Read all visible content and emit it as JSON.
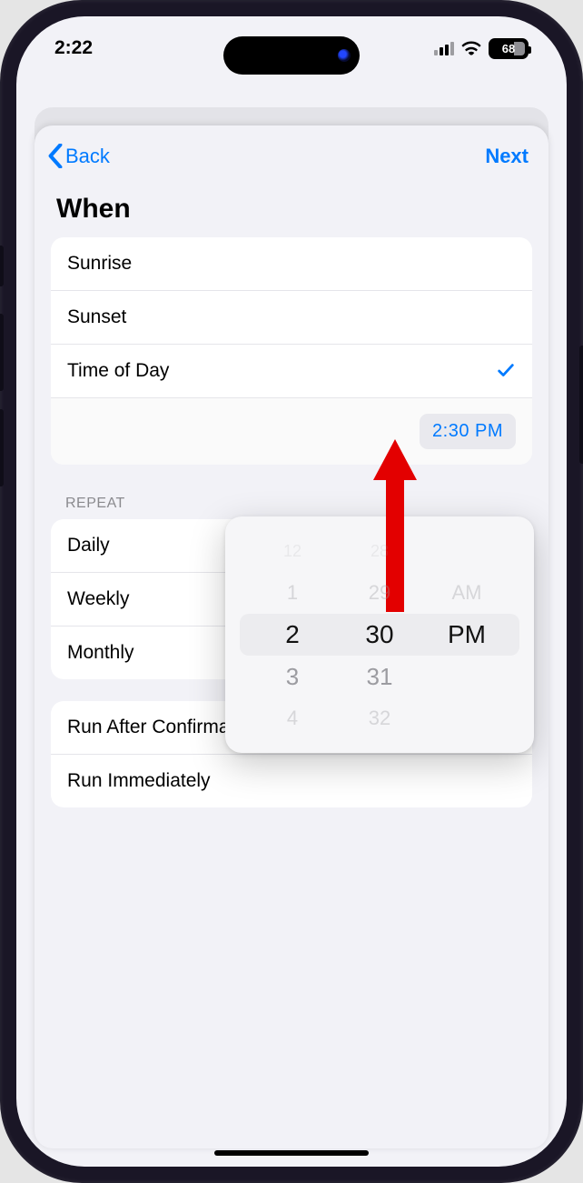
{
  "status": {
    "time": "2:22",
    "battery_pct": "68"
  },
  "nav": {
    "back_label": "Back",
    "next_label": "Next"
  },
  "title": "When",
  "when_options": {
    "sunrise": "Sunrise",
    "sunset": "Sunset",
    "time_of_day": "Time of Day",
    "time_value": "2:30 PM"
  },
  "repeat": {
    "header": "REPEAT",
    "daily": "Daily",
    "weekly": "Weekly",
    "monthly": "Monthly"
  },
  "run": {
    "after_confirm": "Run After Confirmation",
    "immediate": "Run Immediately"
  },
  "picker": {
    "hours": {
      "faint": "12",
      "far_up": "1",
      "sel": "2",
      "down": "3",
      "far_down": "4"
    },
    "minutes": {
      "faint": "28",
      "far_up": "29",
      "sel": "30",
      "down": "31",
      "far_down": "32"
    },
    "period": {
      "up": "AM",
      "sel": "PM"
    }
  }
}
